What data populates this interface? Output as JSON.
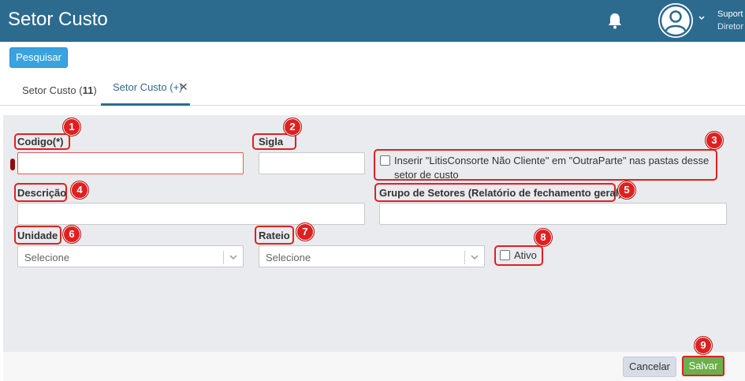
{
  "header": {
    "app_title": "Setor Custo",
    "user_name": "Suport",
    "user_role": "Diretor",
    "icons": [
      "bell-icon",
      "user-avatar-icon",
      "chevron-down-icon"
    ]
  },
  "toolbar": {
    "search_label": "Pesquisar"
  },
  "tabs": [
    {
      "label": "Setor Custo (",
      "count": "11",
      "suffix": ")"
    },
    {
      "label": "Setor Custo (+)",
      "close": "✕"
    }
  ],
  "form": {
    "codigo_label": "Codigo(*)",
    "sigla_label": "Sigla",
    "checkbox_litis_label": "Inserir \"LitisConsorte Não Cliente\" em \"OutraParte\" nas pastas desse setor de custo",
    "descricao_label": "Descrição",
    "grupo_label": "Grupo de Setores (Relatório de fechamento geral)",
    "unidade_label": "Unidade",
    "unidade_value": "Selecione",
    "rateio_label": "Rateio",
    "rateio_value": "Selecione",
    "ativo_label": "Ativo"
  },
  "annotations": [
    "1",
    "2",
    "3",
    "4",
    "5",
    "6",
    "7",
    "8",
    "9"
  ],
  "footer": {
    "cancel_label": "Cancelar",
    "save_label": "Salvar"
  },
  "colors": {
    "header_bg": "#2c6b8e",
    "primary": "#38a3e0",
    "save": "#6ab04c",
    "annotation": "#e02020"
  }
}
